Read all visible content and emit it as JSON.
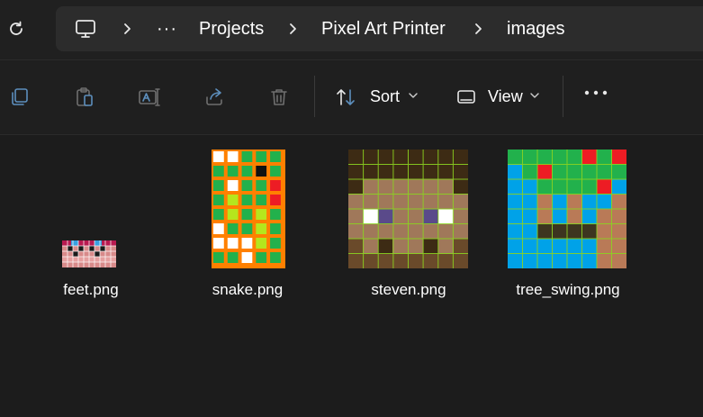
{
  "breadcrumb": {
    "items": [
      {
        "label": "Projects"
      },
      {
        "label": "Pixel Art Printer"
      },
      {
        "label": "images"
      }
    ],
    "overflow": "···"
  },
  "toolbar": {
    "sort_label": "Sort",
    "view_label": "View",
    "more_label": "•••"
  },
  "files": [
    {
      "name": "feet.png"
    },
    {
      "name": "snake.png"
    },
    {
      "name": "steven.png"
    },
    {
      "name": "tree_swing.png"
    }
  ],
  "icons": [
    "refresh-icon",
    "computer-icon",
    "chevron-right-icon",
    "copy-icon",
    "paste-icon",
    "rename-icon",
    "share-icon",
    "delete-icon",
    "sort-icon",
    "chevron-down-icon",
    "view-icon",
    "more-icon"
  ],
  "colors": {
    "accent_grid_green": "#8bd321",
    "snake_orange": "#ff8000",
    "sky_blue": "#00a2e8"
  }
}
